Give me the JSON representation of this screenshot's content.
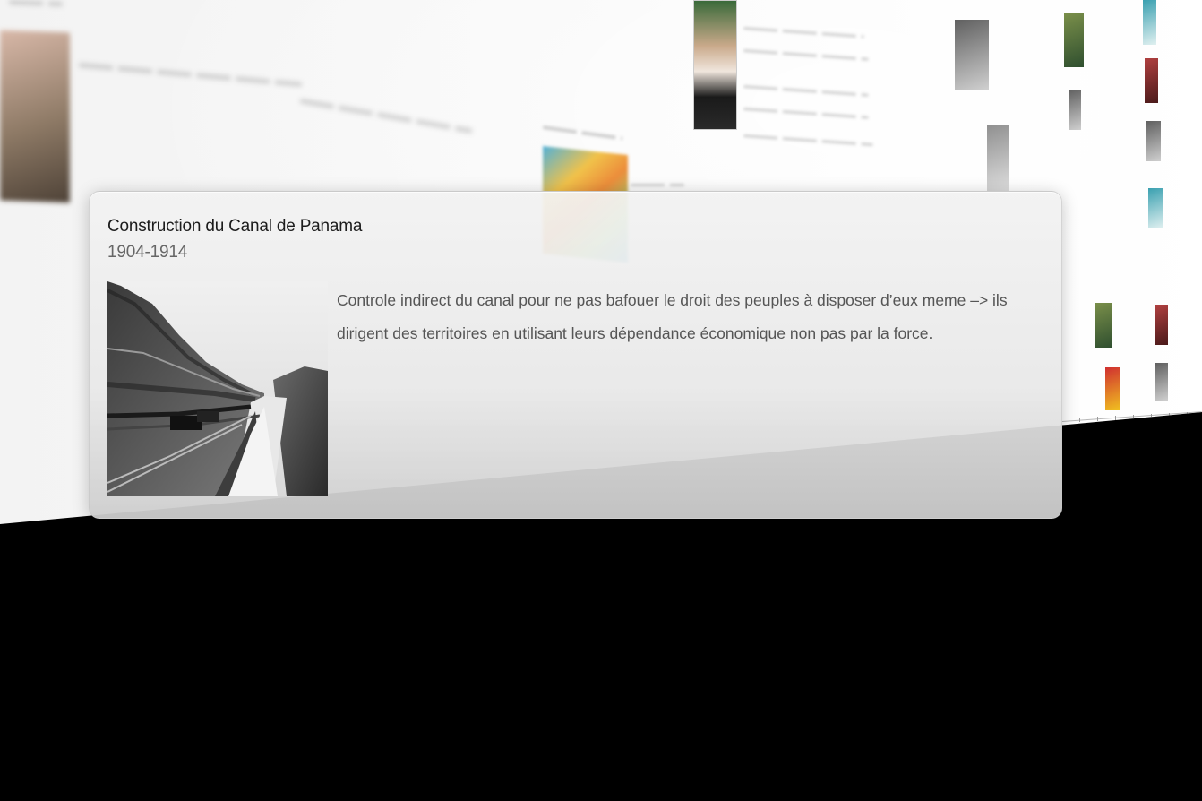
{
  "card": {
    "title": "Construction du Canal de Panama",
    "date": "1904-1914",
    "description": "Controle indirect du canal pour ne pas bafouer le droit des peuples à disposer d’eux meme –> ils dirigent des territoires en utilisant leurs dépendance économique non pas par la force.",
    "image_icon": "canal-photo"
  },
  "background": {
    "colors": {
      "wall": "#f5f5f5",
      "void": "#000000",
      "card": "#e8e8e8"
    }
  }
}
